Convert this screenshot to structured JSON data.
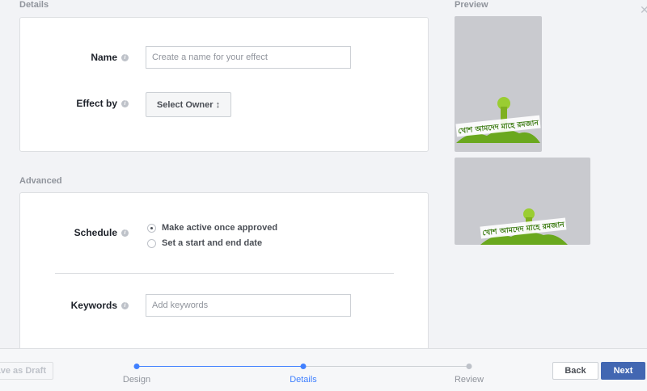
{
  "details": {
    "section_title": "Details",
    "name_label": "Name",
    "name_placeholder": "Create a name for your effect",
    "effect_by_label": "Effect by",
    "select_owner": "Select Owner ↕"
  },
  "advanced": {
    "section_title": "Advanced",
    "schedule_label": "Schedule",
    "options": [
      "Make active once approved",
      "Set a start and end date"
    ],
    "keywords_label": "Keywords",
    "keywords_placeholder": "Add keywords"
  },
  "preview": {
    "title": "Preview",
    "artwork_text": "খোশ আমদেদ মাহে রমজান"
  },
  "footer": {
    "save_draft": "Save as Draft",
    "steps": [
      "Design",
      "Details",
      "Review"
    ],
    "back": "Back",
    "next": "Next"
  },
  "colors": {
    "accent": "#4267b2",
    "step_active": "#4080ff"
  }
}
